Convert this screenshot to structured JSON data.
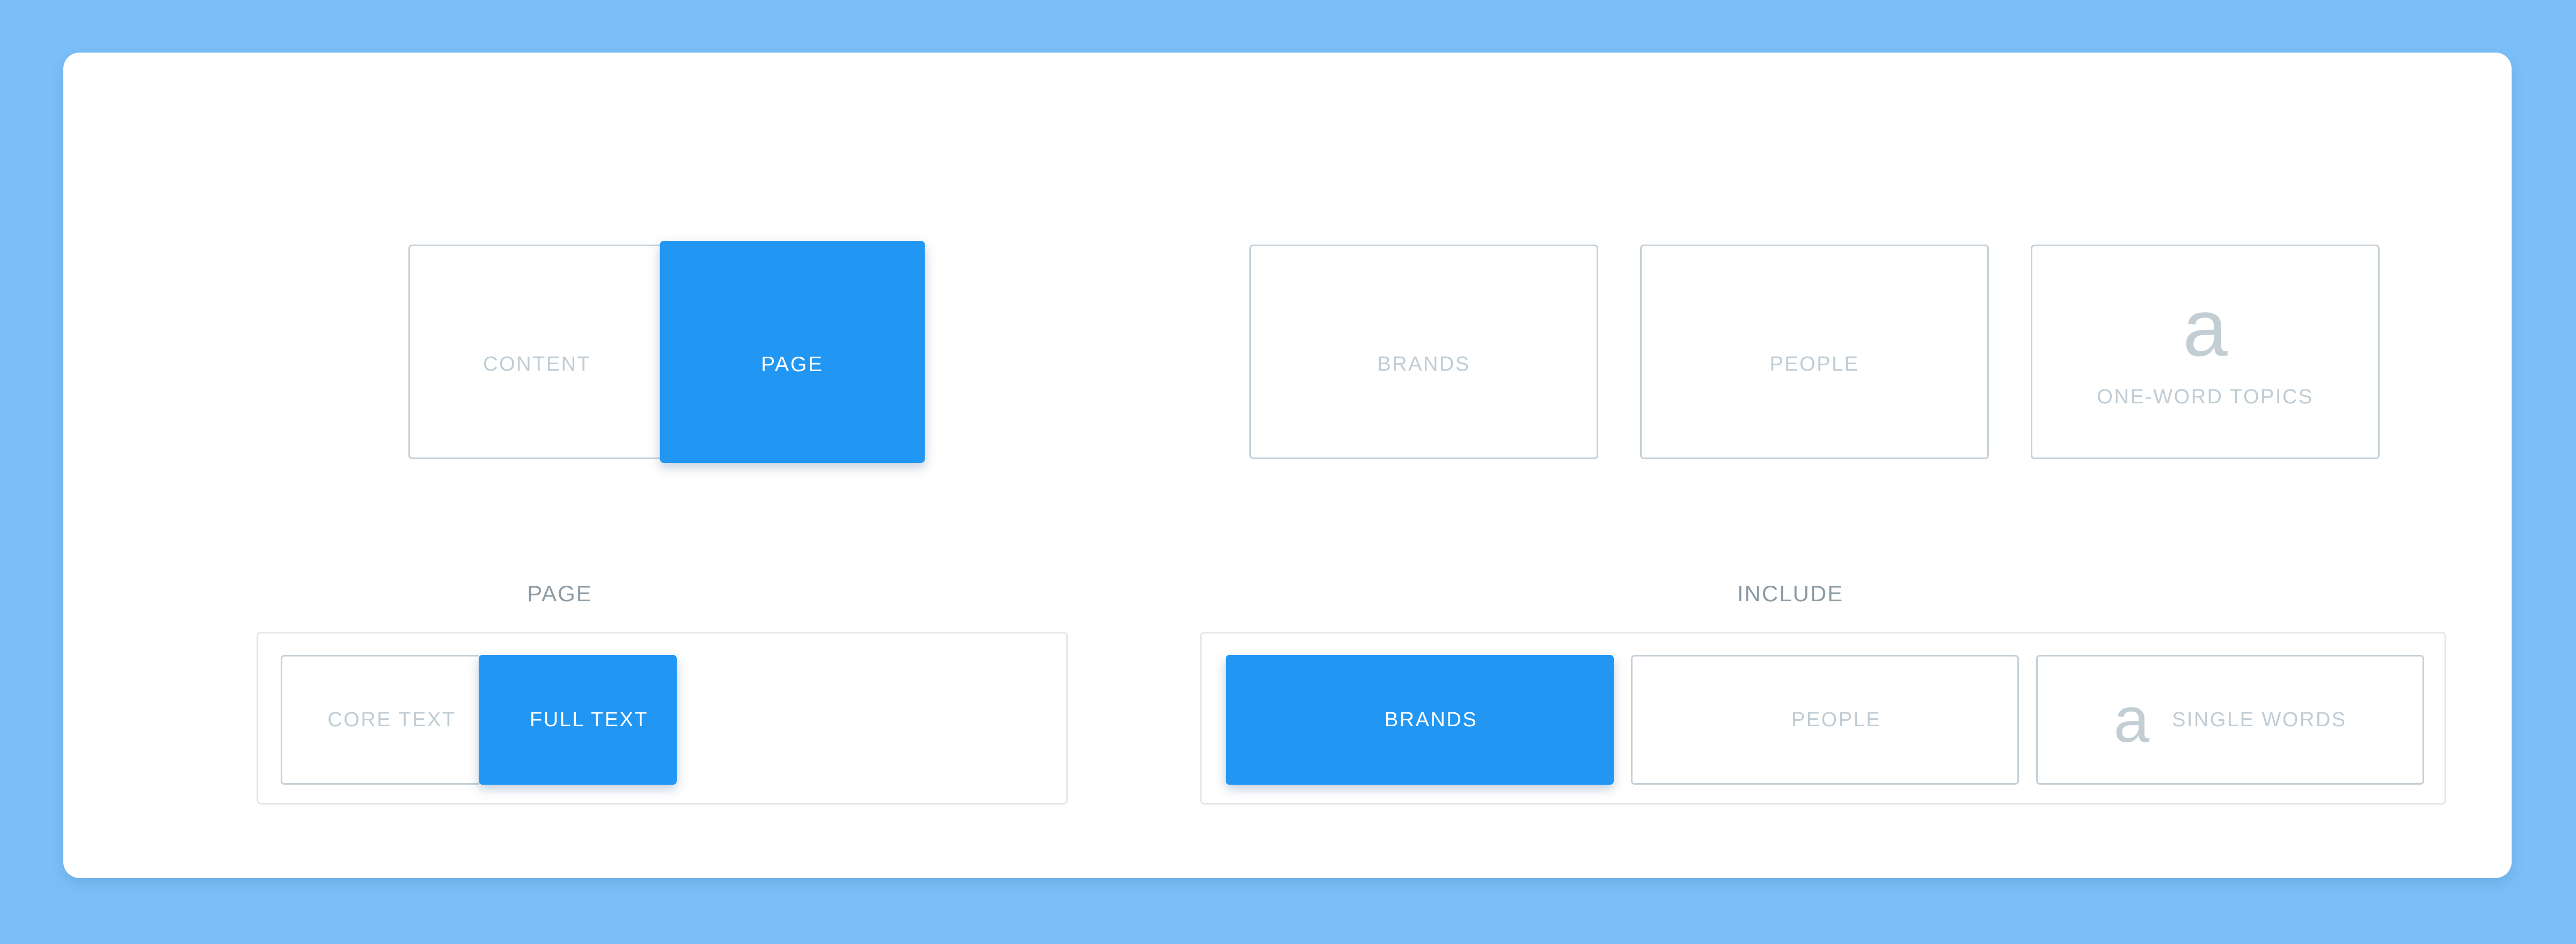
{
  "theme": {
    "background": "#7cbff8",
    "panel": "#ffffff",
    "accent": "#2196f3",
    "label_muted": "#c0ccd4",
    "section_heading": "#8c9ba5",
    "icon_light": "#e7ebee",
    "icon_dark": "#c2cdd4",
    "tile_border": "#c5d0d8",
    "group_border": "#e3e8ec"
  },
  "scope_toggle": {
    "name": "scope",
    "options": [
      {
        "label": "CONTENT",
        "icon": "document-icon",
        "selected": false
      },
      {
        "label": "PAGE",
        "icon": "document-icon",
        "selected": true
      }
    ]
  },
  "entity_cards": {
    "options": [
      {
        "label": "BRANDS",
        "icon": "bar-chart-icon",
        "selected": false
      },
      {
        "label": "PEOPLE",
        "icon": "person-icon",
        "selected": false
      },
      {
        "label": "ONE-WORD TOPICS",
        "icon": "letter-a-icon",
        "selected": false
      }
    ]
  },
  "page_group": {
    "heading": "PAGE",
    "options": [
      {
        "label": "CORE TEXT",
        "icon": "document-icon",
        "selected": false
      },
      {
        "label": "FULL TEXT",
        "icon": "document-icon",
        "selected": true
      }
    ]
  },
  "include_group": {
    "heading": "INCLUDE",
    "options": [
      {
        "label": "BRANDS",
        "icon": "bar-chart-icon",
        "selected": true
      },
      {
        "label": "PEOPLE",
        "icon": "person-icon",
        "selected": false
      },
      {
        "label": "SINGLE WORDS",
        "icon": "letter-a-icon",
        "selected": false
      }
    ]
  },
  "glyphs": {
    "letter_a": "a"
  }
}
